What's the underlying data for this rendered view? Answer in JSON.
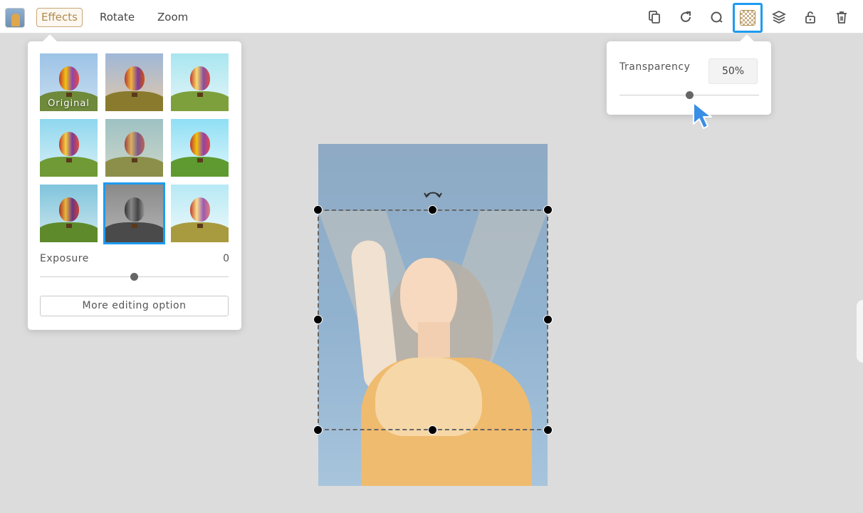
{
  "toolbar": {
    "tabs": [
      {
        "label": "Effects",
        "active": true
      },
      {
        "label": "Rotate",
        "active": false
      },
      {
        "label": "Zoom",
        "active": false
      }
    ],
    "tools": [
      "copy-icon",
      "redo-icon",
      "mask-icon",
      "transparency-icon",
      "layers-icon",
      "lock-icon",
      "trash-icon"
    ],
    "active_tool": "transparency-icon",
    "accent_color": "#1e9bf0",
    "active_tab_color": "#b08a4c"
  },
  "effects_panel": {
    "filters": [
      {
        "id": "original",
        "caption": "Original",
        "selected": false
      },
      {
        "id": "filter-2",
        "caption": "",
        "selected": false
      },
      {
        "id": "filter-3",
        "caption": "",
        "selected": false
      },
      {
        "id": "filter-4",
        "caption": "",
        "selected": false
      },
      {
        "id": "filter-5",
        "caption": "",
        "selected": false
      },
      {
        "id": "filter-6",
        "caption": "",
        "selected": false
      },
      {
        "id": "filter-7",
        "caption": "",
        "selected": false
      },
      {
        "id": "filter-8-grayscale",
        "caption": "",
        "selected": true
      },
      {
        "id": "filter-9",
        "caption": "",
        "selected": false
      }
    ],
    "exposure_label": "Exposure",
    "exposure_value": "0",
    "more_button_label": "More editing option"
  },
  "transparency_panel": {
    "label": "Transparency",
    "value": "50%",
    "slider_fraction": 0.5
  }
}
